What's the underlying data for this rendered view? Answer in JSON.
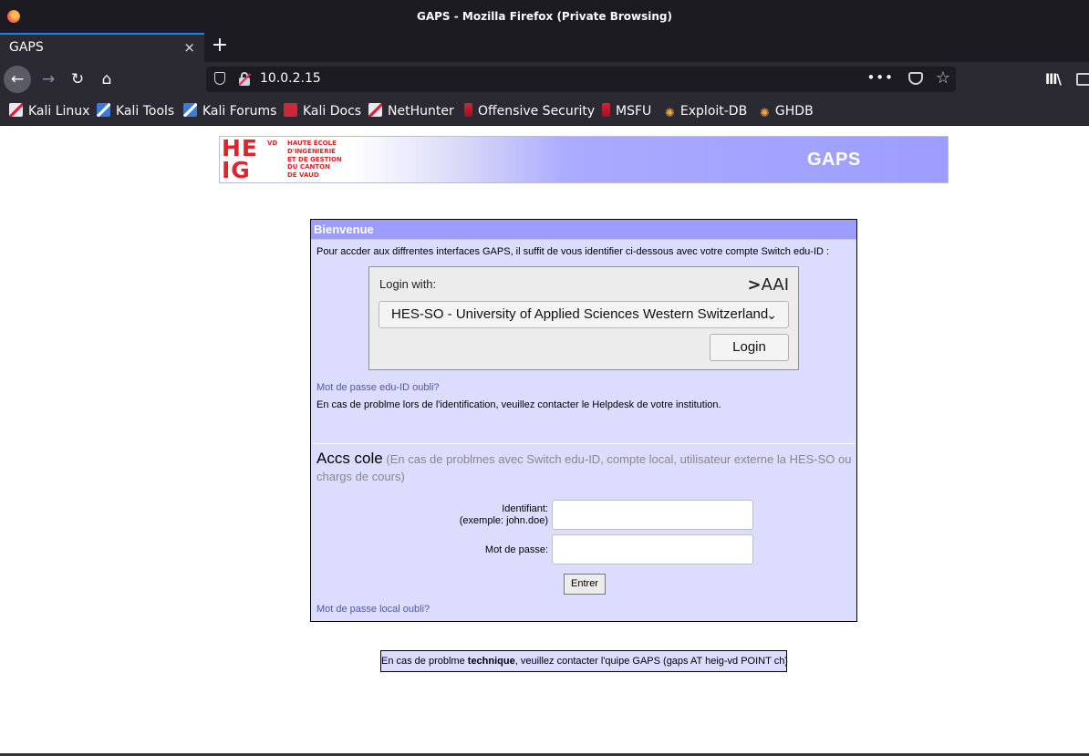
{
  "browser": {
    "window_title": "GAPS - Mozilla Firefox (Private Browsing)",
    "tab_title": "GAPS",
    "tab_close": "×",
    "new_tab": "+",
    "url": "10.0.2.15",
    "page_actions": "•••",
    "bookmarks": [
      {
        "label": "Kali Linux",
        "icon": "kali-linux-icon"
      },
      {
        "label": "Kali Tools",
        "icon": "kali-tools-icon"
      },
      {
        "label": "Kali Forums",
        "icon": "kali-forums-icon"
      },
      {
        "label": "Kali Docs",
        "icon": "kali-docs-icon"
      },
      {
        "label": "NetHunter",
        "icon": "nethunter-icon"
      },
      {
        "label": "Offensive Security",
        "icon": "offensive-security-icon"
      },
      {
        "label": "MSFU",
        "icon": "msfu-icon"
      },
      {
        "label": "Exploit-DB",
        "icon": "exploit-db-icon"
      },
      {
        "label": "GHDB",
        "icon": "ghdb-icon"
      }
    ]
  },
  "banner": {
    "logo_letters_top": "HE",
    "logo_letters_bottom": "IG",
    "logo_vd": "VD",
    "school_line1": "HAUTE ÉCOLE",
    "school_line2": "D'INGÉNIERIE",
    "school_line3": "ET DE GESTION",
    "school_line4": "DU CANTON",
    "school_line5": "DE VAUD",
    "title": "GAPS"
  },
  "welcome": {
    "heading": "Bienvenue",
    "intro": "Pour accder aux diffrentes interfaces GAPS, il suffit de vous identifier ci-dessous avec votre compte Switch edu-ID :",
    "login_with": "Login with:",
    "aai_logo": "AAI",
    "organisation_selected": "HES-SO - University of Applied Sciences Western Switzerland",
    "login_button": "Login",
    "forgot_eduid": "Mot de passe edu-ID oubli?",
    "helpdesk_note": "En cas de problme lors de l'identification, veuillez contacter le Helpdesk de votre institution."
  },
  "local_access": {
    "title": "Accs cole",
    "subtitle": "(En cas de problmes avec Switch edu-ID, compte local, utilisateur externe la HES-SO ou chargs de cours)",
    "identifier_label": "Identifiant:",
    "identifier_hint": "(exemple: john.doe)",
    "identifier_value": "",
    "password_label": "Mot de passe:",
    "password_value": "",
    "submit_button": "Entrer",
    "forgot_local": "Mot de passe local oubli?"
  },
  "footer": {
    "before": "En cas de problme ",
    "bold": "technique",
    "after": ", veuillez contacter l'quipe GAPS (gaps AT heig-vd POINT ch)"
  },
  "colors": {
    "banner_accent": "#9d9dff",
    "panel_background": "#dcdcff",
    "logo_red": "#e1232c",
    "link": "#5555aa"
  }
}
